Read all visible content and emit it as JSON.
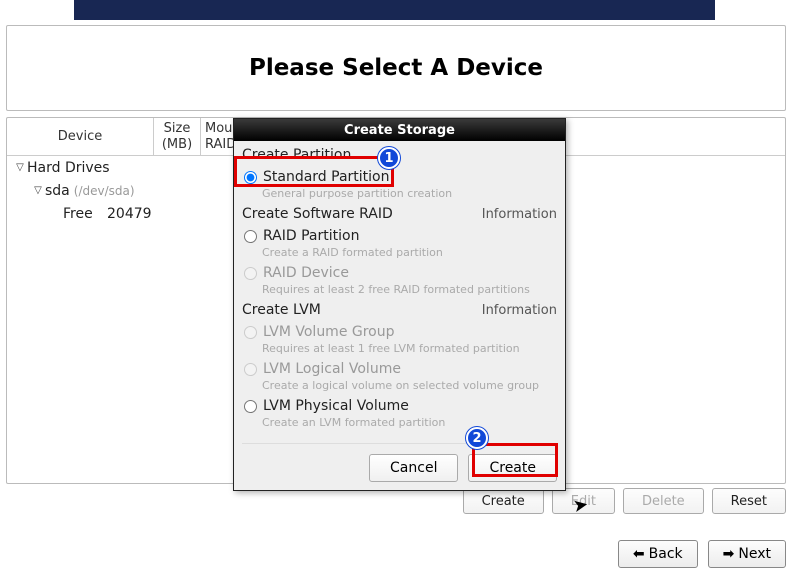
{
  "banner": {},
  "main": {
    "title": "Please Select A Device"
  },
  "table": {
    "headers": {
      "device": "Device",
      "size_l1": "Size",
      "size_l2": "(MB)",
      "mount_l1": "Mou",
      "mount_l2": "RAID"
    },
    "rows": {
      "hard_drives": "Hard Drives",
      "sda_label": "sda",
      "sda_path": "(/dev/sda)",
      "free_label": "Free",
      "free_size": "20479"
    }
  },
  "actions": {
    "create": "Create",
    "edit": "Edit",
    "delete": "Delete",
    "reset": "Reset"
  },
  "nav": {
    "back": "Back",
    "next": "Next"
  },
  "dialog": {
    "title": "Create Storage",
    "section_partition": "Create Partition",
    "opt_standard": "Standard Partition",
    "hint_standard": "General purpose partition creation",
    "section_raid": "Create Software RAID",
    "info": "Information",
    "opt_raid_part": "RAID Partition",
    "hint_raid_part": "Create a RAID formated partition",
    "opt_raid_dev": "RAID Device",
    "hint_raid_dev": "Requires at least 2 free RAID formated partitions",
    "section_lvm": "Create LVM",
    "opt_lvm_vg": "LVM Volume Group",
    "hint_lvm_vg": "Requires at least 1 free LVM formated partition",
    "opt_lvm_lv": "LVM Logical Volume",
    "hint_lvm_lv": "Create a logical volume on selected volume group",
    "opt_lvm_pv": "LVM Physical Volume",
    "hint_lvm_pv": "Create an LVM formated partition",
    "cancel": "Cancel",
    "create": "Create"
  },
  "callouts": {
    "one": "1",
    "two": "2"
  }
}
